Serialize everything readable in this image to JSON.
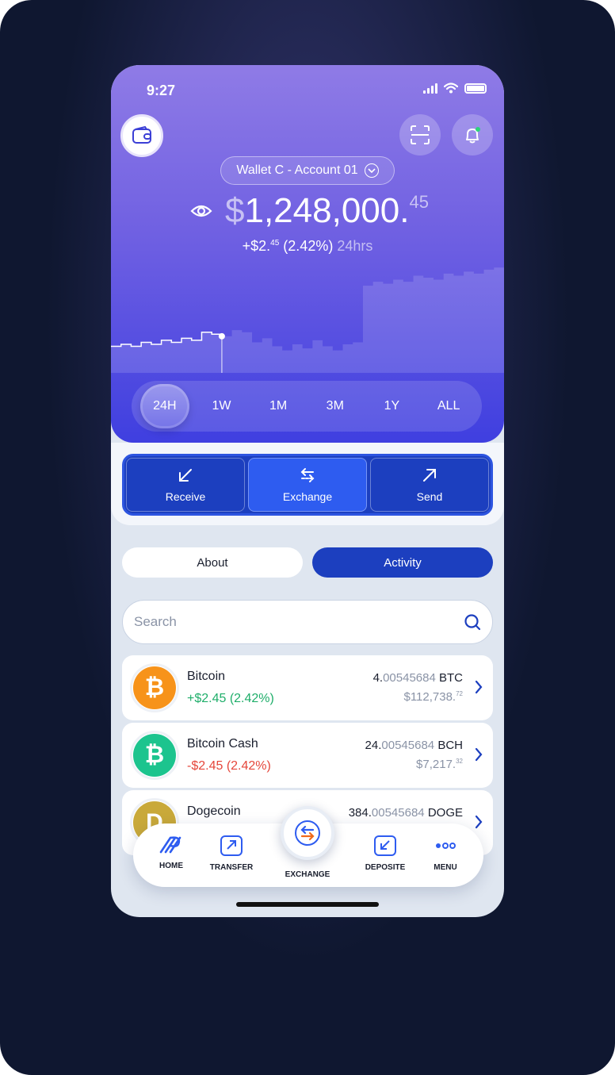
{
  "status_bar": {
    "time": "9:27"
  },
  "header": {
    "account_label": "Wallet C - Account 01",
    "balance": {
      "currency": "$",
      "whole": "1,248,000.",
      "cents": "45"
    },
    "change": {
      "amount": "+$2.",
      "amount_sup": "45",
      "percent": "(2.42%)",
      "period": "24hrs"
    }
  },
  "chart_data": {
    "type": "area",
    "x": [
      0,
      1,
      2,
      3,
      4,
      5,
      6,
      7,
      8,
      9,
      10,
      11,
      12,
      13,
      14,
      15,
      16,
      17,
      18,
      19,
      20,
      21,
      22,
      23,
      24,
      25,
      26,
      27,
      28,
      29,
      30,
      31,
      32,
      33,
      34,
      35,
      36,
      37,
      38,
      39
    ],
    "values": [
      40,
      41,
      40,
      42,
      41,
      43,
      42,
      44,
      43,
      47,
      46,
      45,
      48,
      47,
      42,
      44,
      40,
      38,
      41,
      39,
      43,
      40,
      38,
      41,
      42,
      70,
      72,
      71,
      73,
      72,
      75,
      74,
      73,
      76,
      75,
      77,
      76,
      78,
      79,
      80
    ],
    "highlight_index": 11
  },
  "ranges": {
    "items": [
      "24H",
      "1W",
      "1M",
      "3M",
      "1Y",
      "ALL"
    ],
    "active": 0
  },
  "actions": [
    {
      "label": "Receive",
      "icon": "arrow-down-left-icon"
    },
    {
      "label": "Exchange",
      "icon": "swap-arrows-icon"
    },
    {
      "label": "Send",
      "icon": "arrow-up-right-icon"
    }
  ],
  "tabs": {
    "about": "About",
    "activity": "Activity"
  },
  "search": {
    "placeholder": "Search"
  },
  "coins": [
    {
      "name": "Bitcoin",
      "change": "+$2.45 (2.42%)",
      "direction": "up",
      "amount_int": "4.",
      "amount_frac": "00545684",
      "symbol": "BTC",
      "usd_sign": "$",
      "usd": "112,738.",
      "usd_cents": "72",
      "color": "#f7931a",
      "glyph": "₿"
    },
    {
      "name": "Bitcoin Cash",
      "change": "-$2.45 (2.42%)",
      "direction": "down",
      "amount_int": "24.",
      "amount_frac": "00545684",
      "symbol": "BCH",
      "usd_sign": "$",
      "usd": "7,217.",
      "usd_cents": "32",
      "color": "#1cc48e",
      "glyph": "₿"
    },
    {
      "name": "Dogecoin",
      "change": "",
      "direction": "up",
      "amount_int": "384.",
      "amount_frac": "00545684",
      "symbol": "DOGE",
      "usd_sign": "",
      "usd": "",
      "usd_cents": "",
      "color": "#c9a93a",
      "glyph": "D"
    }
  ],
  "nav": {
    "home": "HOME",
    "transfer": "TRANSFER",
    "exchange": "EXCHANGE",
    "deposite": "DEPOSITE",
    "menu": "MENU"
  },
  "colors": {
    "primary": "#1c3fbf",
    "accent": "#2e5cf0",
    "up": "#1fae6a",
    "down": "#e5463b"
  }
}
